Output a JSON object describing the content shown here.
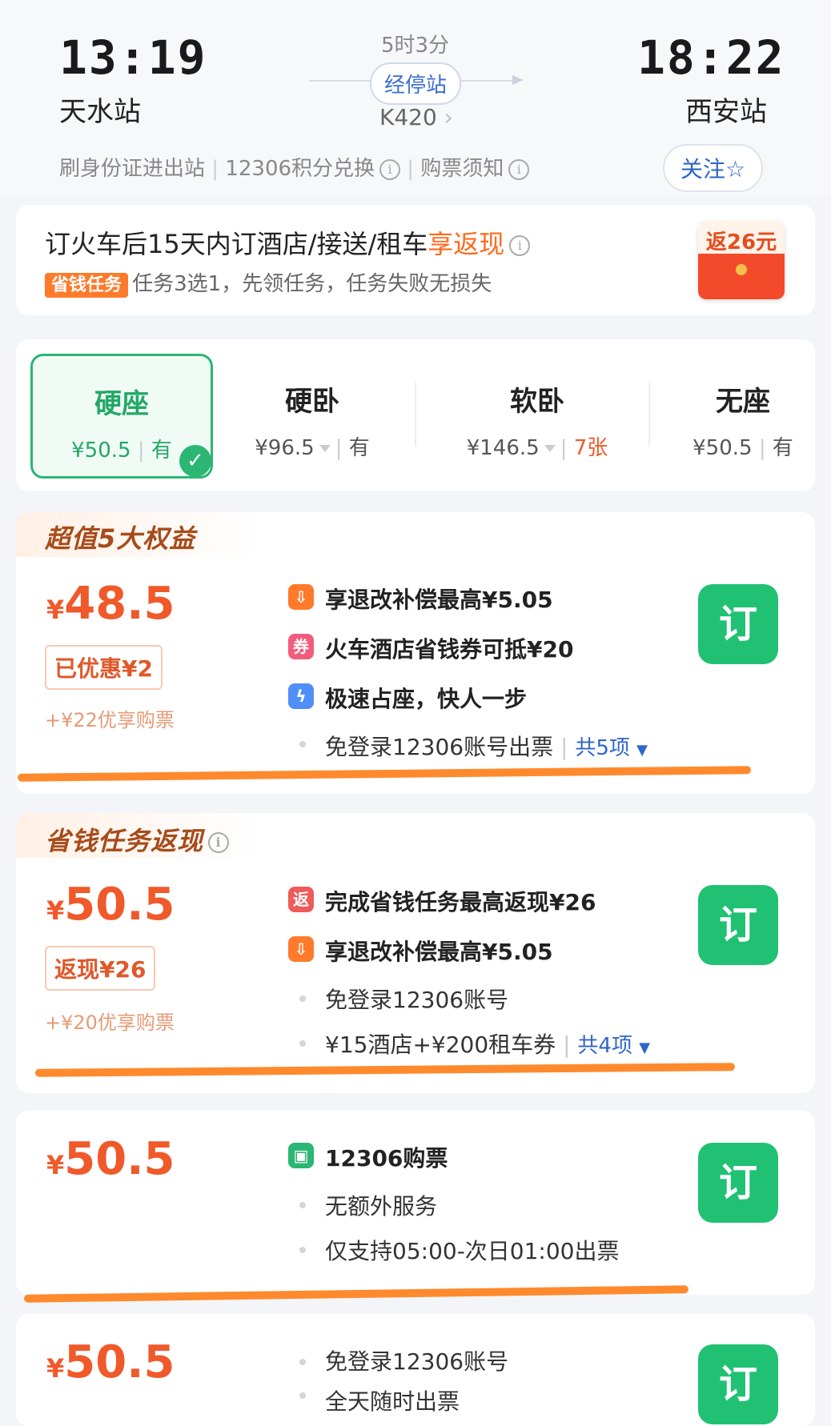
{
  "header": {
    "depart_time": "13:19",
    "depart_station": "天水站",
    "arrive_time": "18:22",
    "arrive_station": "西安站",
    "duration": "5时3分",
    "stops_label": "经停站",
    "train_no": "K420",
    "links": [
      "刷身份证进出站",
      "12306积分兑换",
      "购票须知"
    ],
    "follow_label": "关注"
  },
  "promo": {
    "title_main": "订火车后15天内订酒店/接送/租车",
    "title_highlight": "享返现",
    "tag": "省钱任务",
    "subtitle": "任务3选1，先领任务，任务失败无损失",
    "envelope_label": "返26元"
  },
  "seats": [
    {
      "name": "硬座",
      "price": "¥50.5",
      "avail": "有",
      "selected": true
    },
    {
      "name": "硬卧",
      "price": "¥96.5",
      "avail": "有"
    },
    {
      "name": "软卧",
      "price": "¥146.5",
      "avail": "7张"
    },
    {
      "name": "无座",
      "price": "¥50.5",
      "avail": "有"
    }
  ],
  "offers": [
    {
      "header": "超值5大权益",
      "price_symbol": "¥",
      "price": "48.5",
      "badge": "已优惠¥2",
      "extra": "+¥22优享购票",
      "features": [
        {
          "icon": "refund-icon",
          "text": "享退改补偿最高¥5.05"
        },
        {
          "icon": "coupon-icon",
          "icon_text": "券",
          "text": "火车酒店省钱券可抵¥20"
        },
        {
          "icon": "lightning-icon",
          "text": "极速占座，快人一步"
        }
      ],
      "plain": [
        "免登录12306账号出票"
      ],
      "more": "共5项",
      "book": "订"
    },
    {
      "header": "省钱任务返现",
      "price_symbol": "¥",
      "price": "50.5",
      "badge": "返现¥26",
      "extra": "+¥20优享购票",
      "features": [
        {
          "icon": "cashback-icon",
          "icon_text": "返",
          "text": "完成省钱任务最高返现¥26"
        },
        {
          "icon": "refund-icon",
          "text": "享退改补偿最高¥5.05"
        }
      ],
      "plain": [
        "免登录12306账号",
        "¥15酒店+¥200租车券"
      ],
      "more": "共4项",
      "book": "订"
    },
    {
      "price_symbol": "¥",
      "price": "50.5",
      "features": [
        {
          "icon": "train-icon",
          "text": "12306购票"
        }
      ],
      "plain": [
        "无额外服务",
        "仅支持05:00-次日01:00出票"
      ],
      "book": "订"
    },
    {
      "price_symbol": "¥",
      "price": "50.5",
      "plain": [
        "免登录12306账号",
        "全天随时出票"
      ],
      "book": "订"
    }
  ]
}
